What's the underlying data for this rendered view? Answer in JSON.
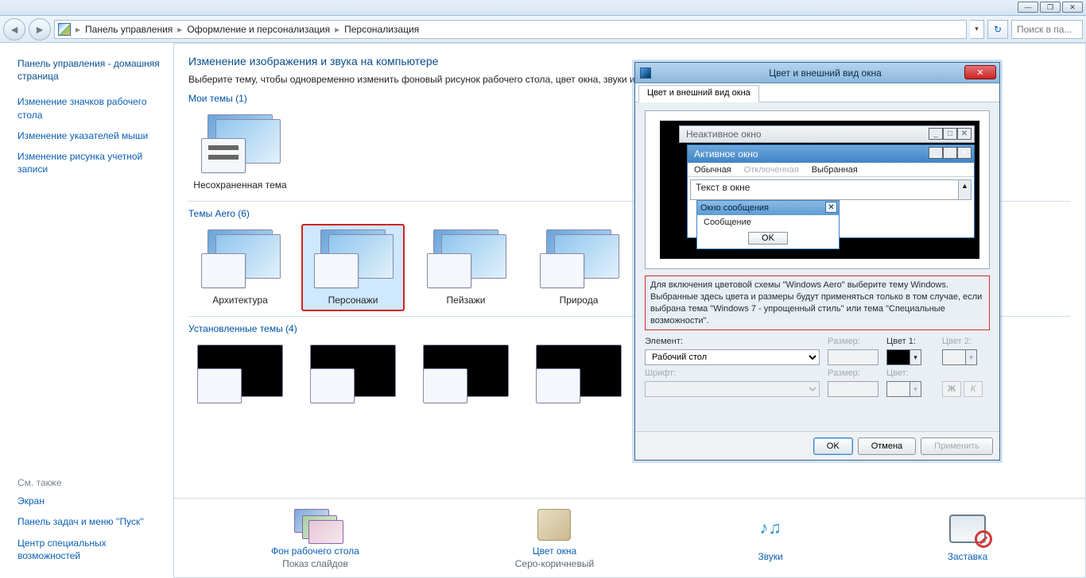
{
  "window_controls": {
    "min": "—",
    "max": "❐",
    "close": "✕"
  },
  "nav": {
    "breadcrumb": [
      "Панель управления",
      "Оформление и персонализация",
      "Персонализация"
    ],
    "search_placeholder": "Поиск в па..."
  },
  "help_tooltip": "?",
  "sidebar": {
    "home": "Панель управления - домашняя страница",
    "links": [
      "Изменение значков рабочего стола",
      "Изменение указателей мыши",
      "Изменение рисунка учетной записи"
    ],
    "see_also_label": "См. также",
    "see_also": [
      "Экран",
      "Панель задач и меню ''Пуск''",
      "Центр специальных возможностей"
    ]
  },
  "main": {
    "heading": "Изменение изображения и звука на компьютере",
    "subtitle": "Выберите тему, чтобы одновременно изменить фоновый рисунок рабочего стола, цвет окна, звуки и з",
    "sections": {
      "my_themes": {
        "label": "Мои темы (1)",
        "items": [
          "Несохраненная тема"
        ]
      },
      "aero": {
        "label": "Темы Aero (6)",
        "items": [
          "Архитектура",
          "Персонажи",
          "Пейзажи",
          "Природа"
        ]
      },
      "installed": {
        "label": "Установленные темы (4)"
      }
    }
  },
  "bottom": {
    "items": [
      {
        "link": "Фон рабочего стола",
        "sub": "Показ слайдов"
      },
      {
        "link": "Цвет окна",
        "sub": "Серо-коричневый"
      },
      {
        "link": "Звуки",
        "sub": ""
      },
      {
        "link": "Заставка",
        "sub": ""
      }
    ]
  },
  "dialog": {
    "title": "Цвет и внешний вид окна",
    "tab": "Цвет и внешний вид окна",
    "preview": {
      "inactive": "Неактивное окно",
      "active": "Активное окно",
      "menu_normal": "Обычная",
      "menu_disabled": "Отключенная",
      "menu_selected": "Выбранная",
      "window_text": "Текст в окне",
      "msg_title": "Окно сообщения",
      "msg_body": "Сообщение",
      "ok": "OK"
    },
    "note": "Для включения цветовой схемы \"Windows Aero\" выберите тему Windows. Выбранные здесь цвета и размеры будут применяться только в том случае, если выбрана тема \"Windows 7 - упрощенный стиль\" или тема \"Специальные возможности\".",
    "labels": {
      "element": "Элемент:",
      "size": "Размер:",
      "color1": "Цвет 1:",
      "color2": "Цвет 2:",
      "font": "Шрифт:",
      "font_size": "Размер:",
      "font_color": "Цвет:"
    },
    "element_value": "Рабочий стол",
    "bold": "Ж",
    "italic": "К",
    "buttons": {
      "ok": "OK",
      "cancel": "Отмена",
      "apply": "Применить"
    }
  }
}
